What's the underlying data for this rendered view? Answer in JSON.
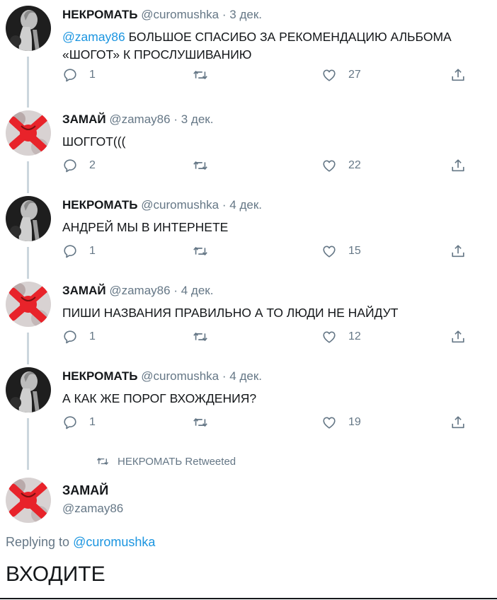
{
  "tweets": [
    {
      "author": "nekromat",
      "name": "НЕКРОМАТЬ",
      "handle": "@curomushka",
      "date": "3 дек.",
      "mention": "@zamay86",
      "text": " БОЛЬШОЕ СПАСИБО ЗА РЕКОМЕНДАЦИЮ АЛЬБОМА «ШОГОТ» К ПРОСЛУШИВАНИЮ",
      "replies": "1",
      "retweets": "",
      "likes": "27"
    },
    {
      "author": "zamay",
      "name": "ЗАМАЙ",
      "handle": "@zamay86",
      "date": "3 дек.",
      "mention": "",
      "text": "ШОГГОТ(((",
      "replies": "2",
      "retweets": "",
      "likes": "22"
    },
    {
      "author": "nekromat",
      "name": "НЕКРОМАТЬ",
      "handle": "@curomushka",
      "date": "4 дек.",
      "mention": "",
      "text": "АНДРЕЙ МЫ В ИНТЕРНЕТЕ",
      "replies": "1",
      "retweets": "",
      "likes": "15"
    },
    {
      "author": "zamay",
      "name": "ЗАМАЙ",
      "handle": "@zamay86",
      "date": "4 дек.",
      "mention": "",
      "text": "ПИШИ НАЗВАНИЯ ПРАВИЛЬНО А ТО ЛЮДИ НЕ НАЙДУТ",
      "replies": "1",
      "retweets": "",
      "likes": "12"
    },
    {
      "author": "nekromat",
      "name": "НЕКРОМАТЬ",
      "handle": "@curomushka",
      "date": "4 дек.",
      "mention": "",
      "text": "А КАК ЖЕ ПОРОГ ВХОЖДЕНИЯ?",
      "replies": "1",
      "retweets": "",
      "likes": "19"
    }
  ],
  "separator": "·",
  "retweet_notice": "НЕКРОМАТЬ Retweeted",
  "main_tweet": {
    "name": "ЗАМАЙ",
    "handle": "@zamay86",
    "replying_prefix": "Replying to ",
    "replying_handle": "@curomushka",
    "text": "ВХОДИТЕ"
  },
  "icons": {
    "reply": "reply-icon",
    "retweet": "retweet-icon",
    "like": "heart-icon",
    "share": "share-icon"
  },
  "colors": {
    "link": "#1b95e0",
    "secondary": "#657786",
    "thread_line": "#ccd6dd",
    "zamay_avatar_red": "#e8232a"
  }
}
